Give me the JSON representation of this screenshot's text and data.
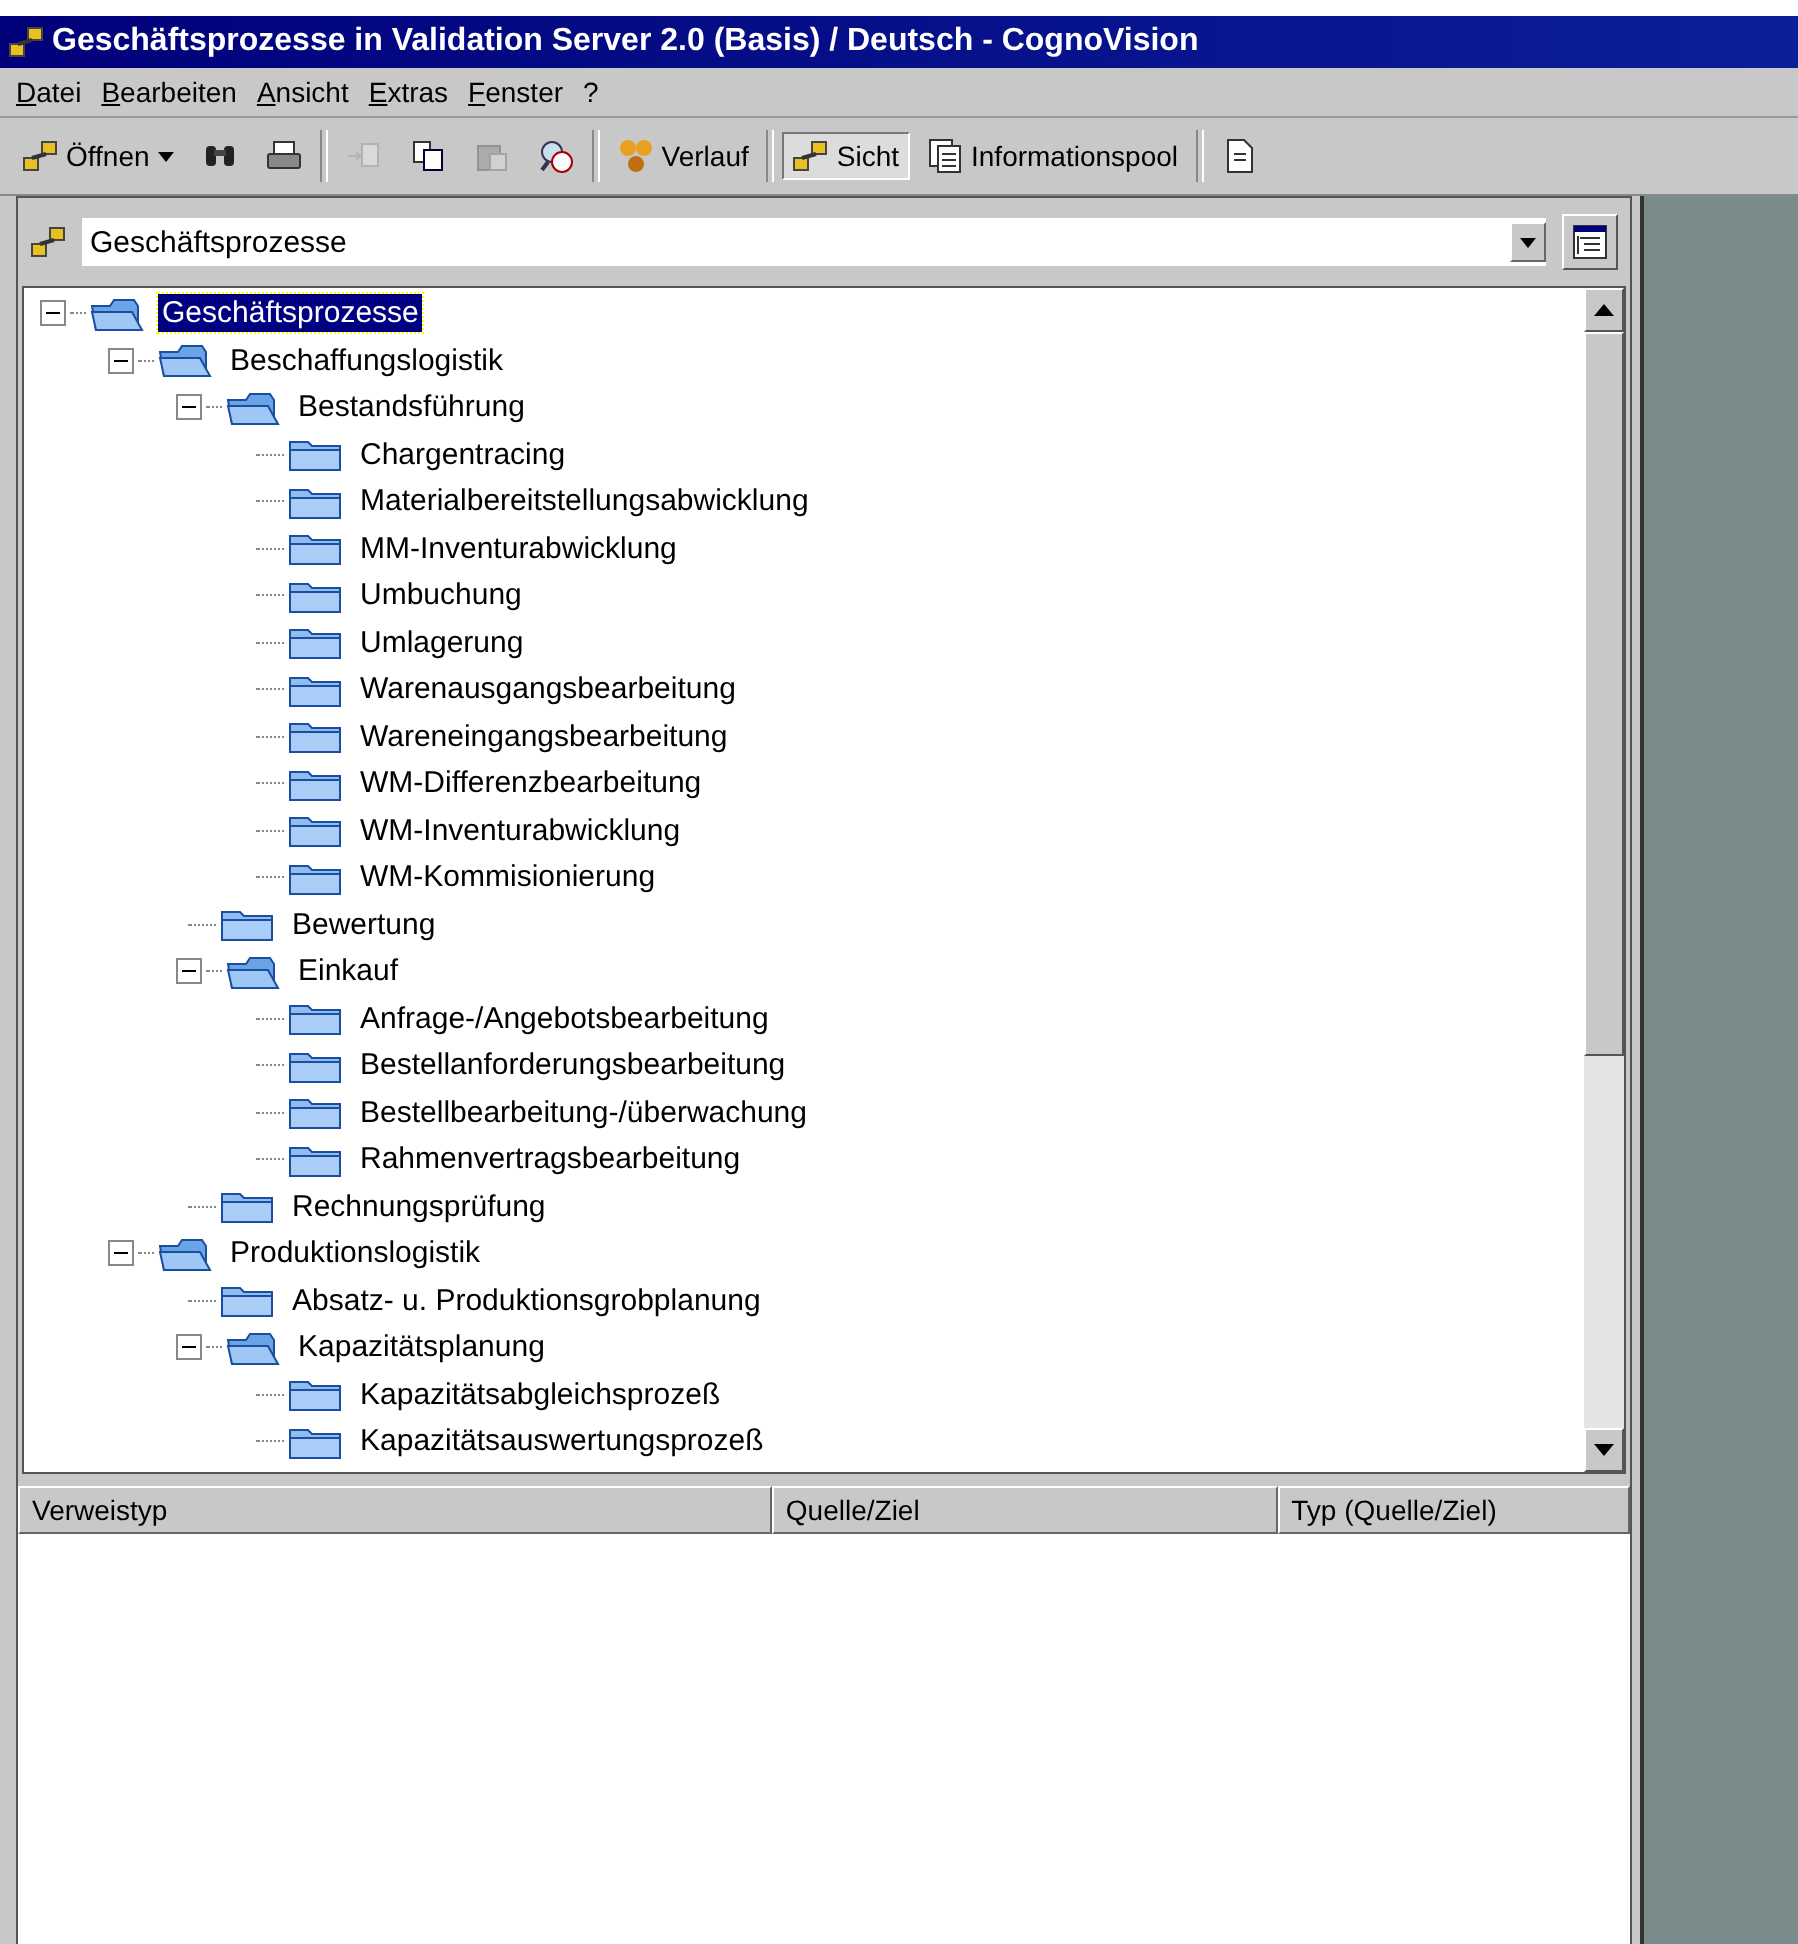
{
  "window": {
    "title": "Geschäftsprozesse in Validation Server 2.0 (Basis) / Deutsch - CognoVision"
  },
  "menu": [
    "Datei",
    "Bearbeiten",
    "Ansicht",
    "Extras",
    "Fenster",
    "?"
  ],
  "toolbar": [
    {
      "kind": "dropdown",
      "label": "Öffnen"
    },
    {
      "kind": "icon",
      "disabled": false
    },
    {
      "kind": "icon",
      "disabled": false
    },
    {
      "kind": "separator"
    },
    {
      "kind": "icon",
      "disabled": true
    },
    {
      "kind": "icon",
      "disabled": false
    },
    {
      "kind": "icon",
      "disabled": true
    },
    {
      "kind": "icon",
      "disabled": false
    },
    {
      "kind": "separator"
    },
    {
      "kind": "view",
      "label": "Verlauf",
      "selected": false
    },
    {
      "kind": "separator"
    },
    {
      "kind": "view",
      "label": "Sicht",
      "selected": true
    },
    {
      "kind": "view",
      "label": "Informationspool",
      "selected": false
    },
    {
      "kind": "separator"
    },
    {
      "kind": "icon",
      "disabled": false
    }
  ],
  "view_selector": {
    "value": "Geschäftsprozesse"
  },
  "tree": [
    {
      "label": "Geschäftsprozesse",
      "selected": true,
      "expanded": true,
      "children": [
        {
          "label": "Beschaffungslogistik",
          "selected": false,
          "expanded": true,
          "children": [
            {
              "label": "Bestandsführung",
              "selected": false,
              "expanded": true,
              "children": [
                {
                  "label": "Chargentracing",
                  "selected": false
                },
                {
                  "label": "Materialbereitstellungsabwicklung",
                  "selected": false
                },
                {
                  "label": "MM-Inventurabwicklung",
                  "selected": false
                },
                {
                  "label": "Umbuchung",
                  "selected": false
                },
                {
                  "label": "Umlagerung",
                  "selected": false
                },
                {
                  "label": "Warenausgangsbearbeitung",
                  "selected": false
                },
                {
                  "label": "Wareneingangsbearbeitung",
                  "selected": false
                },
                {
                  "label": "WM-Differenzbearbeitung",
                  "selected": false
                },
                {
                  "label": "WM-Inventurabwicklung",
                  "selected": false
                },
                {
                  "label": "WM-Kommisionierung",
                  "selected": false
                }
              ]
            },
            {
              "label": "Bewertung",
              "selected": false
            },
            {
              "label": "Einkauf",
              "selected": false,
              "expanded": true,
              "children": [
                {
                  "label": "Anfrage-/Angebotsbearbeitung",
                  "selected": false
                },
                {
                  "label": "Bestellanforderungsbearbeitung",
                  "selected": false
                },
                {
                  "label": "Bestellbearbeitung-/überwachung",
                  "selected": false
                },
                {
                  "label": "Rahmenvertragsbearbeitung",
                  "selected": false
                }
              ]
            },
            {
              "label": "Rechnungsprüfung",
              "selected": false
            }
          ]
        },
        {
          "label": "Produktionslogistik",
          "selected": false,
          "expanded": true,
          "children": [
            {
              "label": "Absatz- u. Produktionsgrobplanung",
              "selected": false
            },
            {
              "label": "Kapazitätsplanung",
              "selected": false,
              "expanded": true,
              "children": [
                {
                  "label": "Kapazitätsabgleichsprozeß",
                  "selected": false
                },
                {
                  "label": "Kapazitätsauswertungsprozeß",
                  "selected": false
                }
              ]
            }
          ]
        }
      ]
    }
  ],
  "reference_table": {
    "columns": [
      "Verweistyp",
      "Quelle/Ziel",
      "Typ (Quelle/Ziel)"
    ]
  }
}
